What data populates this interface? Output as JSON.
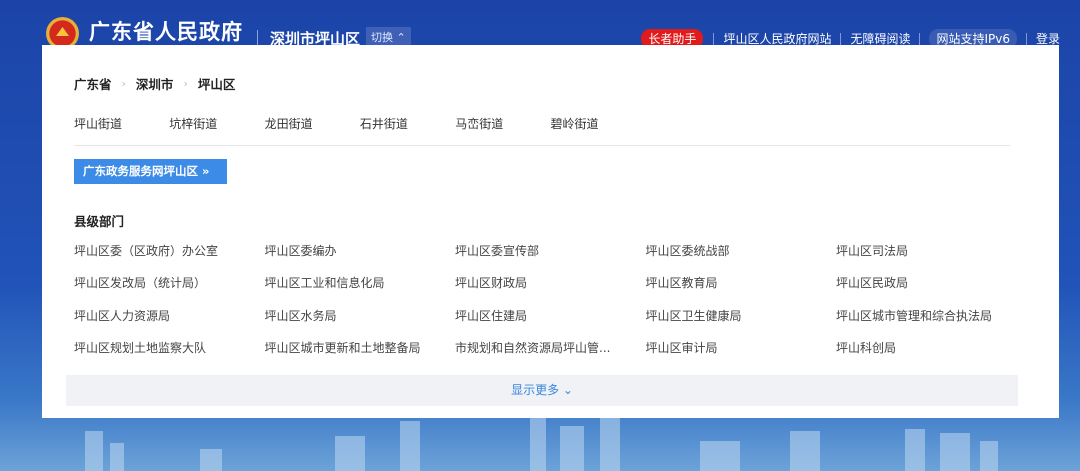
{
  "header": {
    "site_title": "广东省人民政府",
    "city": "深圳市坪山区",
    "switch_label": "切换 ⌃",
    "links": {
      "elder": "长者助手",
      "gov_site": "坪山区人民政府网站",
      "accessible": "无障碍阅读",
      "ipv6": "网站支持IPv6",
      "login": "登录"
    }
  },
  "panel": {
    "breadcrumb": [
      "广东省",
      "深圳市",
      "坪山区"
    ],
    "streets": [
      "坪山街道",
      "坑梓街道",
      "龙田街道",
      "石井街道",
      "马峦街道",
      "碧岭街道"
    ],
    "service_button": "广东政务服务网坪山区 »",
    "section_title": "县级部门",
    "departments": [
      [
        "坪山区委（区政府）办公室",
        "坪山区委编办",
        "坪山区委宣传部",
        "坪山区委统战部",
        "坪山区司法局"
      ],
      [
        "坪山区发改局（统计局）",
        "坪山区工业和信息化局",
        "坪山区财政局",
        "坪山区教育局",
        "坪山区民政局"
      ],
      [
        "坪山区人力资源局",
        "坪山区水务局",
        "坪山区住建局",
        "坪山区卫生健康局",
        "坪山区城市管理和综合执法局"
      ],
      [
        "坪山区规划土地监察大队",
        "坪山区城市更新和土地整备局",
        "市规划和自然资源局坪山管...",
        "坪山区审计局",
        "坪山科创局"
      ]
    ],
    "show_more": "显示更多 ⌄"
  },
  "colors": {
    "header_bg": "#1c44a8",
    "accent": "#3c8ce7",
    "elder_badge": "#e01b1b"
  }
}
